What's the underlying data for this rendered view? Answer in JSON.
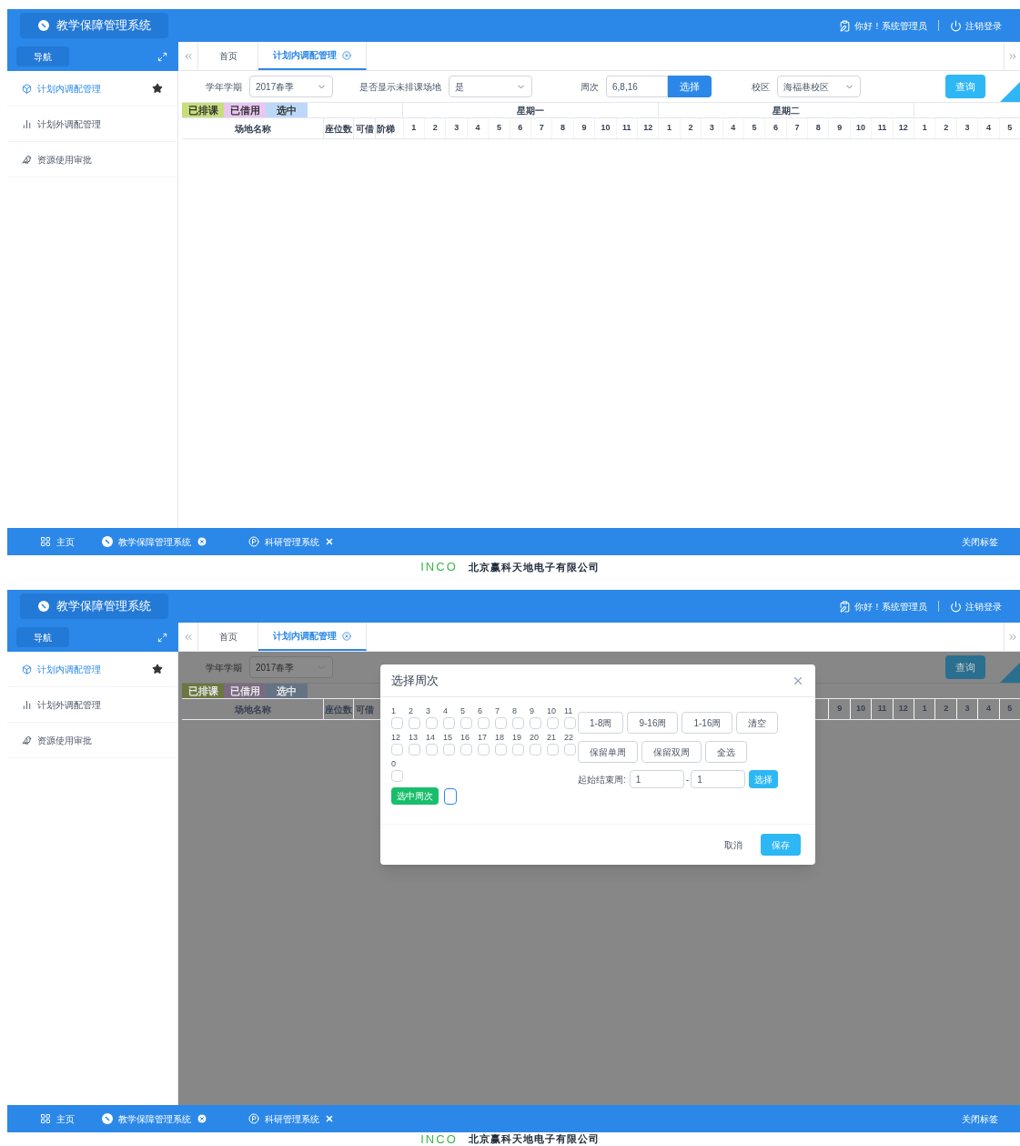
{
  "screens": [
    {
      "header": {
        "title": "教学保障管理系统",
        "greeting": "你好！系统管理员",
        "logout": "注销登录"
      },
      "nav": {
        "label": "导航"
      },
      "tabs": [
        {
          "label": "首页",
          "selected": false,
          "closable": false
        },
        {
          "label": "计划内调配管理",
          "selected": true,
          "closable": true
        }
      ],
      "sidebar": {
        "items": [
          {
            "label": "计划内调配管理",
            "selected": true,
            "starred": true
          },
          {
            "label": "计划外调配管理",
            "selected": false,
            "starred": false
          },
          {
            "label": "资源使用审批",
            "selected": false,
            "starred": false
          }
        ]
      },
      "filters": [
        {
          "label": "学年学期",
          "control": {
            "kind": "select",
            "value": "2017春季"
          }
        },
        {
          "label": "是否显示未排课场地",
          "control": {
            "kind": "select",
            "value": "是"
          }
        },
        {
          "label": "周次",
          "control": {
            "kind": "input",
            "value": "6,8,16",
            "button": "选择"
          }
        },
        {
          "label": "校区",
          "control": {
            "kind": "select",
            "value": "海福巷校区"
          }
        }
      ],
      "query_button": "查询",
      "legend": [
        {
          "label": "已排课",
          "color": "#c6df7c"
        },
        {
          "label": "已借用",
          "color": "#e9c7f2"
        },
        {
          "label": "选中",
          "color": "#bcd8f8"
        }
      ],
      "table": {
        "columns": [
          "场地名称",
          "座位数",
          "可借",
          "阶梯"
        ],
        "days": [
          "星期一",
          "星期二"
        ],
        "period_groups": [
          [
            "1",
            "2",
            "3",
            "4",
            "5",
            "6",
            "7",
            "8",
            "9",
            "10",
            "11",
            "12"
          ],
          [
            "1",
            "2",
            "3",
            "4",
            "5",
            "6",
            "7",
            "8",
            "9",
            "10",
            "11",
            "12"
          ],
          [
            "1",
            "2",
            "3",
            "4",
            "5"
          ]
        ]
      },
      "taskbar": {
        "items": [
          {
            "label": "主页"
          },
          {
            "label": "教学保障管理系统"
          },
          {
            "label": "科研管理系统"
          }
        ],
        "close_all": "关闭标签"
      },
      "company": {
        "logo": "INCO",
        "name": "北京赢科天地电子有限公司"
      }
    },
    {
      "header": {
        "title": "教学保障管理系统",
        "greeting": "你好！系统管理员",
        "logout": "注销登录"
      },
      "nav": {
        "label": "导航"
      },
      "tabs": [
        {
          "label": "首页",
          "selected": false,
          "closable": false
        },
        {
          "label": "计划内调配管理",
          "selected": true,
          "closable": true
        }
      ],
      "sidebar": {
        "items": [
          {
            "label": "计划内调配管理",
            "selected": true,
            "starred": true
          },
          {
            "label": "计划外调配管理",
            "selected": false,
            "starred": false
          },
          {
            "label": "资源使用审批",
            "selected": false,
            "starred": false
          }
        ]
      },
      "filters": [
        {
          "label": "学年学期",
          "control": {
            "kind": "select",
            "value": "2017春季"
          }
        }
      ],
      "query_button": "查询",
      "legend": [
        {
          "label": "已排课",
          "color": "#6a7742"
        },
        {
          "label": "已借用",
          "color": "#7d6a82"
        },
        {
          "label": "选中",
          "color": "#657485"
        }
      ],
      "table": {
        "columns": [
          "场地名称",
          "座位数",
          "可借"
        ],
        "period_groups": [
          [
            "9",
            "10",
            "11",
            "12"
          ],
          [
            "1",
            "2",
            "3",
            "4",
            "5"
          ]
        ]
      },
      "dialog": {
        "title": "选择周次",
        "weeks": [
          {
            "label": "1",
            "checked": false
          },
          {
            "label": "2",
            "checked": false
          },
          {
            "label": "3",
            "checked": false
          },
          {
            "label": "4",
            "checked": false
          },
          {
            "label": "5",
            "checked": false
          },
          {
            "label": "6",
            "checked": false
          },
          {
            "label": "7",
            "checked": false
          },
          {
            "label": "8",
            "checked": false
          },
          {
            "label": "9",
            "checked": false
          },
          {
            "label": "10",
            "checked": false
          },
          {
            "label": "11",
            "checked": false
          },
          {
            "label": "12",
            "checked": false
          },
          {
            "label": "13",
            "checked": false
          },
          {
            "label": "14",
            "checked": false
          },
          {
            "label": "15",
            "checked": false
          },
          {
            "label": "16",
            "checked": false
          },
          {
            "label": "17",
            "checked": false
          },
          {
            "label": "18",
            "checked": false
          },
          {
            "label": "19",
            "checked": false
          },
          {
            "label": "20",
            "checked": false
          },
          {
            "label": "21",
            "checked": false
          },
          {
            "label": "22",
            "checked": false
          },
          {
            "label": "0",
            "checked": false
          }
        ],
        "selected_tag": "选中周次",
        "preset_rows": [
          [
            "1-8周",
            "9-16周",
            "1-16周",
            "清空"
          ],
          [
            "保留单周",
            "保留双周",
            "全选"
          ]
        ],
        "range": {
          "label": "起始结束周:",
          "start": "1",
          "separator": "-",
          "end": "1",
          "button": "选择"
        },
        "cancel": "取消",
        "save": "保存"
      },
      "taskbar": {
        "items": [
          {
            "label": "主页"
          },
          {
            "label": "教学保障管理系统"
          },
          {
            "label": "科研管理系统"
          }
        ],
        "close_all": "关闭标签"
      },
      "company": {
        "logo": "INCO",
        "name": "北京赢科天地电子有限公司"
      }
    }
  ]
}
